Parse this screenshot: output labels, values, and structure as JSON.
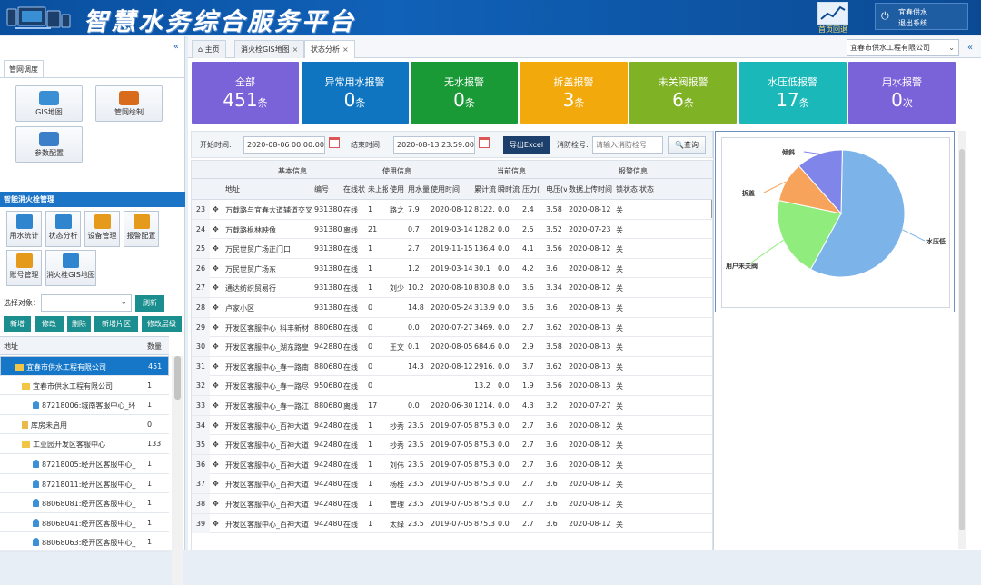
{
  "header": {
    "title": "智慧水务综合服务平台",
    "home_label": "首页回退",
    "user_name": "宜春供水",
    "logout": "退出系统"
  },
  "sidebar": {
    "collapse_icon": "double-chevron-left-icon",
    "tab": "管网调度",
    "top_buttons": [
      "GIS地图",
      "管网绘制",
      "参数配置"
    ],
    "section_title": "智能消火栓管理",
    "small_buttons": [
      "用水统计",
      "状态分析",
      "设备管理",
      "报警配置",
      "账号管理",
      "消火栓GIS地图"
    ],
    "select_label": "选择对象：",
    "refresh": "刷新",
    "actions": [
      "新增",
      "修改",
      "删除",
      "新增片区",
      "修改层级"
    ],
    "tree_header": {
      "address": "地址",
      "count": "数量"
    },
    "tree": [
      {
        "label": "宜春市供水工程有限公司",
        "count": "451",
        "selected": true,
        "indent": 16,
        "kind": "folder"
      },
      {
        "label": "宜春市供水工程有限公司",
        "count": "1",
        "indent": 24,
        "kind": "folder"
      },
      {
        "label": "87218006:城南客服中心_环",
        "count": "1",
        "indent": 36,
        "kind": "pin"
      },
      {
        "label": "库房未启用",
        "count": "0",
        "indent": 24,
        "kind": "doc"
      },
      {
        "label": "工业园开发区客服中心",
        "count": "133",
        "indent": 24,
        "kind": "folder"
      },
      {
        "label": "87218005:经开区客服中心_",
        "count": "1",
        "indent": 36,
        "kind": "pin"
      },
      {
        "label": "87218011:经开区客服中心_",
        "count": "1",
        "indent": 36,
        "kind": "pin"
      },
      {
        "label": "88068081:经开区客服中心_",
        "count": "1",
        "indent": 36,
        "kind": "pin"
      },
      {
        "label": "88068041:经开区客服中心_",
        "count": "1",
        "indent": 36,
        "kind": "pin"
      },
      {
        "label": "88068063:经开区客服中心_",
        "count": "1",
        "indent": 36,
        "kind": "pin"
      }
    ]
  },
  "tabs": [
    {
      "label": "主页",
      "icon": "home-icon"
    },
    {
      "label": "消火栓GIS地图",
      "close": "×"
    },
    {
      "label": "状态分析",
      "close": "×",
      "active": true
    }
  ],
  "company_select": "宜春市供水工程有限公司",
  "cards": [
    {
      "title": "全部",
      "value": "451",
      "unit": "条",
      "color": "#7a63d9"
    },
    {
      "title": "异常用水报警",
      "value": "0",
      "unit": "条",
      "color": "#0f75c1"
    },
    {
      "title": "无水报警",
      "value": "0",
      "unit": "条",
      "color": "#1a9a37"
    },
    {
      "title": "拆盖报警",
      "value": "3",
      "unit": "条",
      "color": "#f1a90c"
    },
    {
      "title": "未关阀报警",
      "value": "6",
      "unit": "条",
      "color": "#80b226"
    },
    {
      "title": "水压低报警",
      "value": "17",
      "unit": "条",
      "color": "#1ab8b8"
    },
    {
      "title": "用水报警",
      "value": "0",
      "unit": "次",
      "color": "#7a63d9"
    }
  ],
  "filter": {
    "start_label": "开始时间:",
    "start": "2020-08-06 00:00:00",
    "end_label": "结束时间:",
    "end": "2020-08-13 23:59:00",
    "excel": "导出Excel",
    "hydrant_label": "消防栓号:",
    "hydrant_placeholder": "请输入消防栓号",
    "query": "查询"
  },
  "grid": {
    "groups": [
      "基本信息",
      "使用信息",
      "当前信息",
      "报警信息"
    ],
    "columns": [
      "地址",
      "编号",
      "在线状",
      "未上报",
      "使用",
      "用水量",
      "使用时间",
      "累计流",
      "瞬时流",
      "压力(",
      "电压(v",
      "数据上传时间",
      "锁状态",
      "状态"
    ],
    "rows": [
      [
        "23",
        "万载路与宜春大道辅道交叉",
        "931380",
        "在线",
        "1",
        "路之",
        "7.9",
        "2020-08-12",
        "8122.",
        "0.0",
        "2.4",
        "3.58",
        "2020-08-12",
        "关",
        ""
      ],
      [
        "24",
        "万载路枫林映像",
        "931380",
        "离线",
        "21",
        "",
        "0.7",
        "2019-03-14",
        "128.2",
        "0.0",
        "2.5",
        "3.52",
        "2020-07-23",
        "关",
        ""
      ],
      [
        "25",
        "万民世贸广场正门口",
        "931380",
        "在线",
        "1",
        "",
        "2.7",
        "2019-11-15",
        "136.4",
        "0.0",
        "4.1",
        "3.56",
        "2020-08-12",
        "关",
        ""
      ],
      [
        "26",
        "万民世贸广场东",
        "931380",
        "在线",
        "1",
        "",
        "1.2",
        "2019-03-14",
        "30.1",
        "0.0",
        "4.2",
        "3.6",
        "2020-08-12",
        "关",
        ""
      ],
      [
        "27",
        "通达纺织贸易行",
        "931380",
        "在线",
        "1",
        "刘少",
        "10.2",
        "2020-08-10",
        "830.8",
        "0.0",
        "3.6",
        "3.34",
        "2020-08-12",
        "关",
        ""
      ],
      [
        "28",
        "卢家小区",
        "931380",
        "在线",
        "0",
        "",
        "14.8",
        "2020-05-24",
        "313.9",
        "0.0",
        "3.6",
        "3.6",
        "2020-08-13",
        "关",
        ""
      ],
      [
        "29",
        "开发区客服中心_科丰新材",
        "880680",
        "在线",
        "0",
        "",
        "0.0",
        "2020-07-27",
        "3469.",
        "0.0",
        "2.7",
        "3.62",
        "2020-08-13",
        "关",
        ""
      ],
      [
        "30",
        "开发区客服中心_湖东路皇",
        "942880",
        "在线",
        "0",
        "王文",
        "0.1",
        "2020-08-05",
        "684.6",
        "0.0",
        "2.9",
        "3.58",
        "2020-08-13",
        "关",
        ""
      ],
      [
        "31",
        "开发区客服中心_春一路南",
        "880680",
        "在线",
        "0",
        "",
        "14.3",
        "2020-08-12",
        "2916.",
        "0.0",
        "3.7",
        "3.62",
        "2020-08-13",
        "关",
        ""
      ],
      [
        "32",
        "开发区客服中心_春一路尽",
        "950680",
        "在线",
        "0",
        "",
        "",
        "",
        "13.2",
        "0.0",
        "1.9",
        "3.56",
        "2020-08-13",
        "关",
        ""
      ],
      [
        "33",
        "开发区客服中心_春一路江",
        "880680",
        "离线",
        "17",
        "",
        "0.0",
        "2020-06-30",
        "1214.",
        "0.0",
        "4.3",
        "3.2",
        "2020-07-27",
        "关",
        ""
      ],
      [
        "34",
        "开发区客服中心_百神大道",
        "942480",
        "在线",
        "1",
        "抄秀",
        "23.5",
        "2019-07-05",
        "875.3",
        "0.0",
        "2.7",
        "3.6",
        "2020-08-12",
        "关",
        ""
      ],
      [
        "35",
        "开发区客服中心_百神大道",
        "942480",
        "在线",
        "1",
        "抄秀",
        "23.5",
        "2019-07-05",
        "875.3",
        "0.0",
        "2.7",
        "3.6",
        "2020-08-12",
        "关",
        ""
      ],
      [
        "36",
        "开发区客服中心_百神大道",
        "942480",
        "在线",
        "1",
        "刘伟",
        "23.5",
        "2019-07-05",
        "875.3",
        "0.0",
        "2.7",
        "3.6",
        "2020-08-12",
        "关",
        ""
      ],
      [
        "37",
        "开发区客服中心_百神大道",
        "942480",
        "在线",
        "1",
        "杨桂",
        "23.5",
        "2019-07-05",
        "875.3",
        "0.0",
        "2.7",
        "3.6",
        "2020-08-12",
        "关",
        ""
      ],
      [
        "38",
        "开发区客服中心_百神大道",
        "942480",
        "在线",
        "1",
        "管理",
        "23.5",
        "2019-07-05",
        "875.3",
        "0.0",
        "2.7",
        "3.6",
        "2020-08-12",
        "关",
        ""
      ],
      [
        "39",
        "开发区客服中心_百神大道",
        "942480",
        "在线",
        "1",
        "太绿",
        "23.5",
        "2019-07-05",
        "875.3",
        "0.0",
        "2.7",
        "3.6",
        "2020-08-12",
        "关",
        ""
      ]
    ]
  },
  "chart_data": {
    "type": "pie",
    "title": "",
    "slices": [
      {
        "label": "水压低",
        "value": 17,
        "color": "#7cb4ea"
      },
      {
        "label": "用户未关阀",
        "value": 6,
        "color": "#90ed7d"
      },
      {
        "label": "拆盖",
        "value": 3,
        "color": "#f7a35c"
      },
      {
        "label": "倾斜",
        "value": 3.5,
        "color": "#8085e9"
      }
    ]
  }
}
